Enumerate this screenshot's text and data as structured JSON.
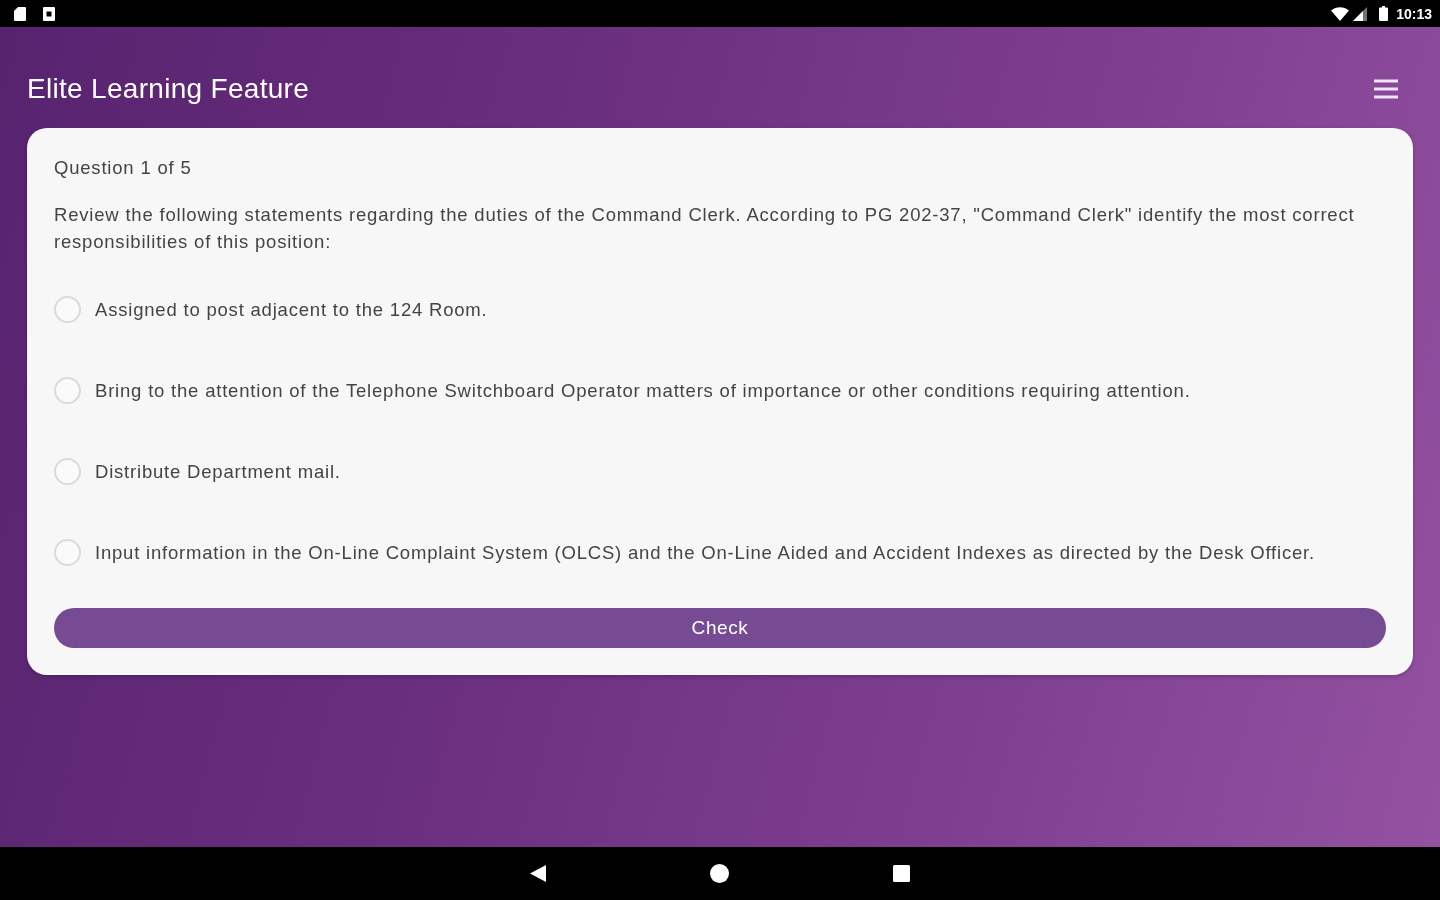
{
  "status_bar": {
    "time": "10:13"
  },
  "app_bar": {
    "title": "Elite Learning Feature"
  },
  "quiz": {
    "question_number": "Question 1 of 5",
    "question": "Review the following statements regarding the duties of the Command Clerk. According to PG 202-37, \"Command Clerk\" identify the most correct responsibilities of this position:",
    "options": [
      {
        "label": "Assigned to post adjacent to the 124 Room.",
        "selected": false
      },
      {
        "label": "Bring to the attention of the Telephone Switchboard Operator matters of importance or other conditions requiring attention.",
        "selected": false
      },
      {
        "label": "Distribute Department mail.",
        "selected": false
      },
      {
        "label": "Input information in the On-Line Complaint System (OLCS) and the On-Line Aided and Accident Indexes as directed by the Desk Officer.",
        "selected": false
      }
    ],
    "check_button": "Check"
  }
}
